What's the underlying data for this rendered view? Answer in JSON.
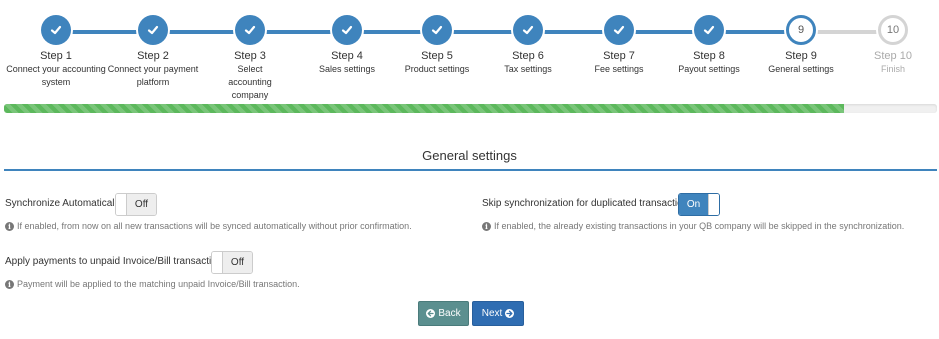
{
  "steps": [
    {
      "title": "Step 1",
      "desc": "Connect your accounting system",
      "state": "done"
    },
    {
      "title": "Step 2",
      "desc": "Connect your payment platform",
      "state": "done"
    },
    {
      "title": "Step 3",
      "desc": "Select accounting company",
      "state": "done"
    },
    {
      "title": "Step 4",
      "desc": "Sales settings",
      "state": "done"
    },
    {
      "title": "Step 5",
      "desc": "Product settings",
      "state": "done"
    },
    {
      "title": "Step 6",
      "desc": "Tax settings",
      "state": "done"
    },
    {
      "title": "Step 7",
      "desc": "Fee settings",
      "state": "done"
    },
    {
      "title": "Step 8",
      "desc": "Payout settings",
      "state": "done"
    },
    {
      "title": "Step 9",
      "desc": "General settings",
      "state": "current",
      "number": "9"
    },
    {
      "title": "Step 10",
      "desc": "Finish",
      "state": "todo",
      "number": "10"
    }
  ],
  "progress": {
    "fraction": 0.9,
    "color": "#5cb85c"
  },
  "section": {
    "title": "General settings"
  },
  "settings": {
    "sync_auto": {
      "label": "Synchronize Automatically",
      "value": "Off",
      "help": "If enabled, from now on all new transactions will be synced automatically without prior confirmation."
    },
    "skip_dup": {
      "label": "Skip synchronization for duplicated transactions",
      "value": "On",
      "help": "If enabled, the already existing transactions in your QB company will be skipped in the synchronization."
    },
    "apply_payments": {
      "label": "Apply payments to unpaid Invoice/Bill transactions",
      "value": "Off",
      "help": "Payment will be applied to the matching unpaid Invoice/Bill transaction."
    }
  },
  "buttons": {
    "back": "Back",
    "next": "Next"
  },
  "colors": {
    "accent": "#3f84bd",
    "back_button": "#5b8f8f",
    "next_button": "#2f6db2"
  },
  "icons": {
    "step_done": "checkmark-icon",
    "info": "info-icon",
    "back": "circle-arrow-left-icon",
    "next": "circle-arrow-right-icon"
  }
}
